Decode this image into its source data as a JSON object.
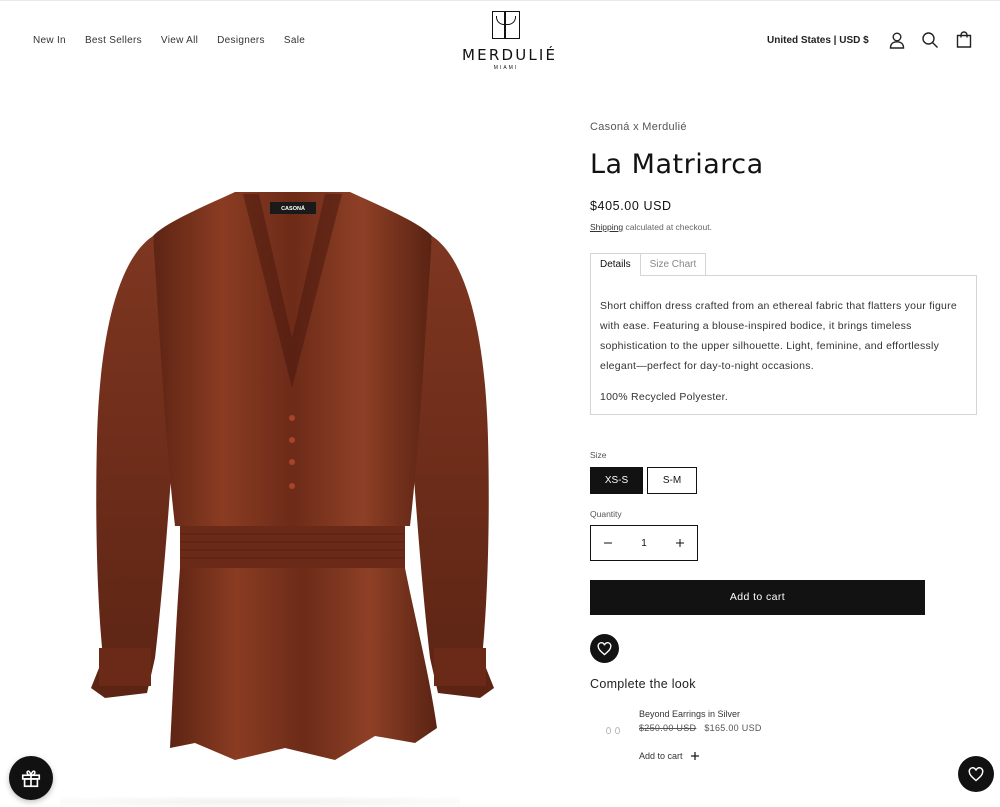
{
  "header": {
    "nav": [
      "New In",
      "Best Sellers",
      "View All",
      "Designers",
      "Sale"
    ],
    "logo_word": "MERDULIÉ",
    "logo_sub": "MIAMI",
    "region": "United States | USD $",
    "icons": [
      "account-icon",
      "search-icon",
      "cart-icon"
    ]
  },
  "product": {
    "vendor": "Casoná x Merdulié",
    "title": "La Matriarca",
    "price": "$405.00 USD",
    "shipping_link": "Shipping",
    "shipping_text": " calculated at checkout.",
    "tabs": [
      "Details",
      "Size Chart"
    ],
    "active_tab": "Details",
    "description": "Short chiffon dress crafted from an ethereal fabric that flatters your figure with ease. Featuring a blouse-inspired bodice, it brings timeless sophistication to the upper silhouette. Light, feminine, and effortlessly elegant—perfect for day-to-night occasions.",
    "material": "100% Recycled Polyester.",
    "size_label": "Size",
    "sizes": [
      "XS-S",
      "S-M"
    ],
    "selected_size": "XS-S",
    "quantity_label": "Quantity",
    "quantity": "1",
    "add_to_cart": "Add to cart",
    "image_label_brand": "CASONÁ",
    "image_label_sub": "MERDULIÉ"
  },
  "complete_the_look": {
    "title": "Complete the look",
    "item_name": "Beyond Earrings in Silver",
    "compare_price": "$250.00 USD",
    "sale_price": "$165.00 USD",
    "add_label": "Add to cart"
  },
  "colors": {
    "primary": "#121212",
    "dress": "#7a3420",
    "text_muted": "#555555"
  }
}
